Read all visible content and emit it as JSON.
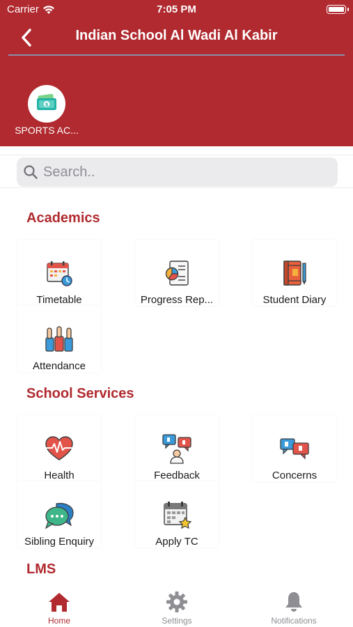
{
  "status_bar": {
    "carrier": "Carrier",
    "time": "7:05 PM"
  },
  "header": {
    "title": "Indian School Al Wadi Al Kabir"
  },
  "quick_access": [
    {
      "label": "SPORTS AC...",
      "icon": "cash-icon"
    }
  ],
  "search": {
    "placeholder": "Search.."
  },
  "sections": [
    {
      "title": "Academics",
      "items": [
        {
          "label": "Timetable",
          "icon": "calendar-clock-icon"
        },
        {
          "label": "Progress Rep...",
          "icon": "report-chart-icon"
        },
        {
          "label": "Student Diary",
          "icon": "diary-icon"
        },
        {
          "label": "Attendance",
          "icon": "raised-hands-icon"
        }
      ]
    },
    {
      "title": "School Services",
      "items": [
        {
          "label": "Health",
          "icon": "heart-pulse-icon"
        },
        {
          "label": "Feedback",
          "icon": "feedback-icon"
        },
        {
          "label": "Concerns",
          "icon": "concerns-icon"
        },
        {
          "label": "Sibling Enquiry",
          "icon": "chat-bubbles-icon"
        },
        {
          "label": "Apply TC",
          "icon": "calendar-star-icon"
        }
      ]
    },
    {
      "title": "LMS",
      "items": []
    }
  ],
  "tab_bar": [
    {
      "label": "Home",
      "icon": "home-icon",
      "active": true
    },
    {
      "label": "Settings",
      "icon": "gear-icon",
      "active": false
    },
    {
      "label": "Notifications",
      "icon": "bell-icon",
      "active": false
    }
  ],
  "colors": {
    "brand_red": "#b02a2f",
    "inactive_gray": "#8e8e93"
  }
}
